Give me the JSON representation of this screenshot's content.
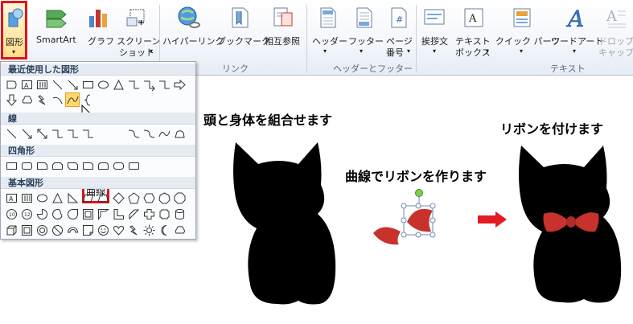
{
  "ribbon": {
    "buttons": [
      {
        "label": "図形",
        "icon": "shapes-icon"
      },
      {
        "label": "SmartArt",
        "icon": "smartart-icon"
      },
      {
        "label": "グラフ",
        "icon": "chart-icon"
      },
      {
        "label": "スクリーン",
        "label2": "ショット",
        "icon": "screenshot-icon"
      },
      {
        "label": "ハイパーリンク",
        "icon": "hyperlink-icon"
      },
      {
        "label": "ブックマーク",
        "icon": "bookmark-icon"
      },
      {
        "label": "相互参照",
        "icon": "cross-reference-icon"
      },
      {
        "label": "ヘッダー",
        "icon": "header-icon"
      },
      {
        "label": "フッター",
        "icon": "footer-icon"
      },
      {
        "label": "ページ",
        "label2": "番号",
        "icon": "page-number-icon"
      },
      {
        "label": "挨拶文",
        "icon": "greeting-icon"
      },
      {
        "label": "テキスト",
        "label2": "ボックス",
        "icon": "textbox-icon"
      },
      {
        "label": "クイック パーツ",
        "icon": "quick-parts-icon"
      },
      {
        "label": "ワードアート",
        "icon": "wordart-icon"
      },
      {
        "label": "ドロップ",
        "label2": "キャップ",
        "icon": "drop-cap-icon"
      }
    ],
    "groups": {
      "links": "リンク",
      "header_footer": "ヘッダーとフッター",
      "text": "テキスト"
    },
    "dropdown_glyph": "▾"
  },
  "gallery": {
    "categories": {
      "recent": "最近使用した図形",
      "lines": "線",
      "rectangles": "四角形",
      "basic": "基本図形"
    },
    "tooltip": "曲線"
  },
  "illustration": {
    "caption_combine": "頭と身体を組合せます",
    "caption_curve": "曲線でリボンを作ります",
    "caption_attach": "リボンを付けます",
    "colors": {
      "ribbon": "#c8322d",
      "cat": "#000000",
      "arrow": "#e31b23",
      "handle": "#7ed14f"
    }
  },
  "colors": {
    "highlight": "#e0141d",
    "selected": "#ffd76e"
  }
}
